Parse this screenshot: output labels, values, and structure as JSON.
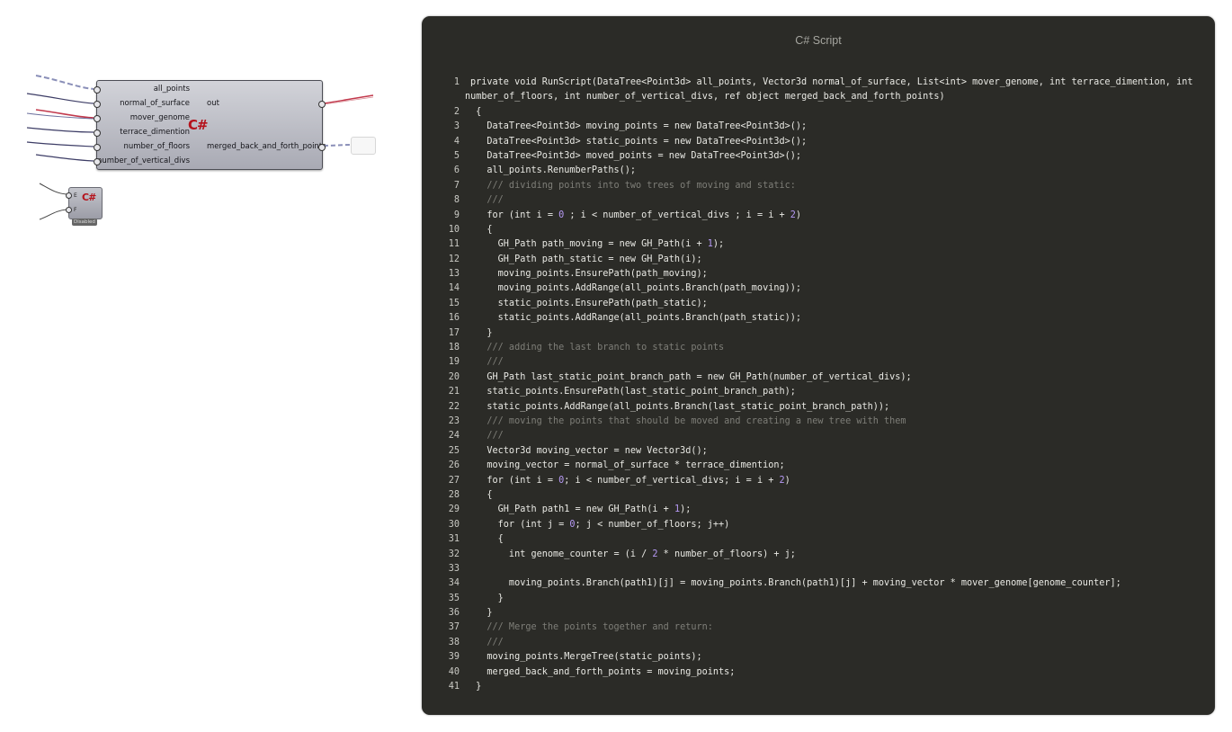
{
  "canvas": {
    "component": {
      "inputs": [
        "all_points",
        "normal_of_surface",
        "mover_genome",
        "terrace_dimention",
        "number_of_floors",
        "number_of_vertical_divs"
      ],
      "outputs": [
        "out",
        "merged_back_and_forth_points"
      ],
      "logo": "C#"
    },
    "mini_component": {
      "inputs": [
        "E",
        "F"
      ],
      "logo": "C#",
      "status": "Disabled"
    }
  },
  "editor": {
    "title": "C# Script",
    "lines": [
      {
        "n": "1",
        "text": "private void RunScript(DataTree<Point3d> all_points, Vector3d normal_of_surface, List<int> mover_genome, int terrace_dimention, int",
        "cont": "number_of_floors, int number_of_vertical_divs, ref object merged_back_and_forth_points)"
      },
      {
        "n": "2",
        "text": " {"
      },
      {
        "n": "3",
        "text": "   DataTree<Point3d> moving_points = new DataTree<Point3d>();"
      },
      {
        "n": "4",
        "text": "   DataTree<Point3d> static_points = new DataTree<Point3d>();"
      },
      {
        "n": "5",
        "text": "   DataTree<Point3d> moved_points = new DataTree<Point3d>();"
      },
      {
        "n": "6",
        "text": "   all_points.RenumberPaths();"
      },
      {
        "n": "7",
        "text": "   /// dividing points into two trees of moving and static:"
      },
      {
        "n": "8",
        "text": "   ///"
      },
      {
        "n": "9",
        "text": "   for (int i = 0 ; i < number_of_vertical_divs ; i = i + 2)"
      },
      {
        "n": "10",
        "text": "   {"
      },
      {
        "n": "11",
        "text": "     GH_Path path_moving = new GH_Path(i + 1);"
      },
      {
        "n": "12",
        "text": "     GH_Path path_static = new GH_Path(i);"
      },
      {
        "n": "13",
        "text": "     moving_points.EnsurePath(path_moving);"
      },
      {
        "n": "14",
        "text": "     moving_points.AddRange(all_points.Branch(path_moving));"
      },
      {
        "n": "15",
        "text": "     static_points.EnsurePath(path_static);"
      },
      {
        "n": "16",
        "text": "     static_points.AddRange(all_points.Branch(path_static));"
      },
      {
        "n": "17",
        "text": "   }"
      },
      {
        "n": "18",
        "text": "   /// adding the last branch to static points"
      },
      {
        "n": "19",
        "text": "   ///"
      },
      {
        "n": "20",
        "text": "   GH_Path last_static_point_branch_path = new GH_Path(number_of_vertical_divs);"
      },
      {
        "n": "21",
        "text": "   static_points.EnsurePath(last_static_point_branch_path);"
      },
      {
        "n": "22",
        "text": "   static_points.AddRange(all_points.Branch(last_static_point_branch_path));"
      },
      {
        "n": "23",
        "text": "   /// moving the points that should be moved and creating a new tree with them"
      },
      {
        "n": "24",
        "text": "   ///"
      },
      {
        "n": "25",
        "text": "   Vector3d moving_vector = new Vector3d();"
      },
      {
        "n": "26",
        "text": "   moving_vector = normal_of_surface * terrace_dimention;"
      },
      {
        "n": "27",
        "text": "   for (int i = 0; i < number_of_vertical_divs; i = i + 2)"
      },
      {
        "n": "28",
        "text": "   {"
      },
      {
        "n": "29",
        "text": "     GH_Path path1 = new GH_Path(i + 1);"
      },
      {
        "n": "30",
        "text": "     for (int j = 0; j < number_of_floors; j++)"
      },
      {
        "n": "31",
        "text": "     {"
      },
      {
        "n": "32",
        "text": "       int genome_counter = (i / 2 * number_of_floors) + j;"
      },
      {
        "n": "33",
        "text": ""
      },
      {
        "n": "34",
        "text": "       moving_points.Branch(path1)[j] = moving_points.Branch(path1)[j] + moving_vector * mover_genome[genome_counter];"
      },
      {
        "n": "35",
        "text": "     }"
      },
      {
        "n": "36",
        "text": "   }"
      },
      {
        "n": "37",
        "text": "   /// Merge the points together and return:"
      },
      {
        "n": "38",
        "text": "   ///"
      },
      {
        "n": "39",
        "text": "   moving_points.MergeTree(static_points);"
      },
      {
        "n": "40",
        "text": "   merged_back_and_forth_points = moving_points;"
      },
      {
        "n": "41",
        "text": " }"
      }
    ]
  },
  "colors": {
    "editor_bg": "#2b2b27",
    "code_text": "#e9e9e4",
    "comment": "#7e7e78",
    "number": "#b79af6",
    "logo_red": "#b5121b"
  }
}
